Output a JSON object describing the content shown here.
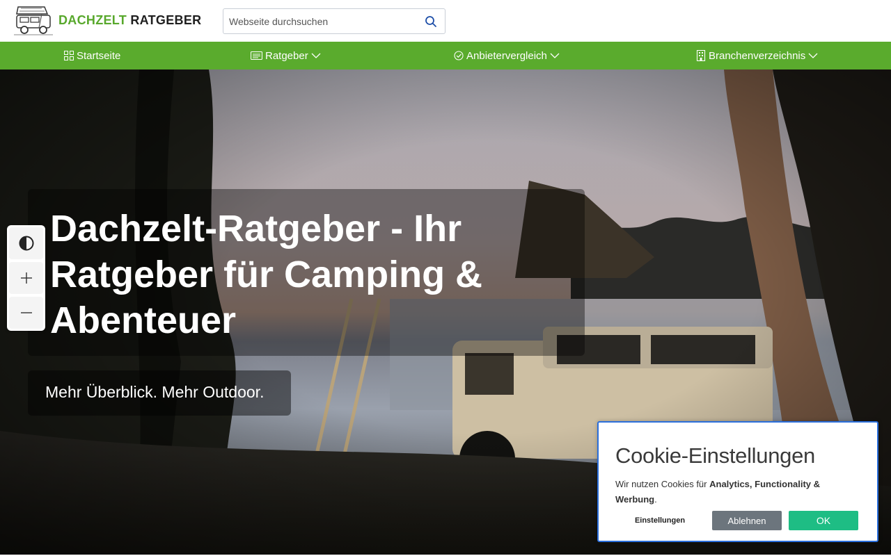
{
  "header": {
    "logo": {
      "word1": "DACHZELT",
      "word2": "RATGEBER",
      "brand_green": "#58a82c",
      "icon": "car-with-rooftop-tent-icon"
    },
    "search": {
      "placeholder": "Webseite durchsuchen",
      "value": "",
      "icon": "search-icon"
    }
  },
  "nav": {
    "background": "#5aab2d",
    "items": [
      {
        "label": "Startseite",
        "icon": "grid-icon",
        "dropdown": false
      },
      {
        "label": "Ratgeber",
        "icon": "newspaper-icon",
        "dropdown": true
      },
      {
        "label": "Anbietervergleich",
        "icon": "check-circle-icon",
        "dropdown": true
      },
      {
        "label": "Branchenverzeichnis",
        "icon": "building-icon",
        "dropdown": true
      }
    ]
  },
  "hero": {
    "title": "Dachzelt-Ratgeber - Ihr Ratgeber für Camping & Abenteuer",
    "subtitle": "Mehr Überblick. Mehr Outdoor."
  },
  "accessibility_toolbar": {
    "buttons": [
      {
        "name": "contrast-toggle",
        "icon": "contrast-icon"
      },
      {
        "name": "zoom-in",
        "icon": "plus-icon"
      },
      {
        "name": "zoom-out",
        "icon": "minus-icon"
      }
    ]
  },
  "cookie_dialog": {
    "title": "Cookie-Einstellungen",
    "text_prefix": "Wir nutzen Cookies für ",
    "text_bold": "Analytics, Functionality & Werbung",
    "text_suffix": ".",
    "settings_label": "Einstellungen",
    "decline_label": "Ablehnen",
    "ok_label": "OK",
    "decline_color": "#6c757d",
    "ok_color": "#1ebd84",
    "border_color": "#2b6fdc"
  }
}
